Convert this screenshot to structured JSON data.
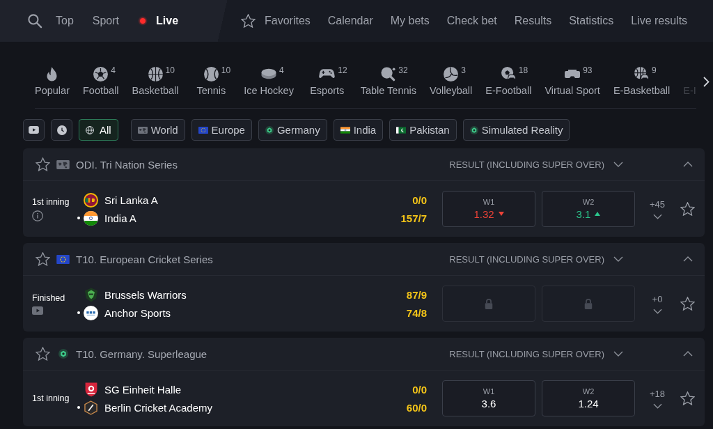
{
  "nav": {
    "primary": [
      {
        "label": "Top",
        "selected": false,
        "kind": "plain"
      },
      {
        "label": "Sport",
        "selected": false,
        "kind": "plain"
      },
      {
        "label": "Live",
        "selected": true,
        "kind": "live"
      }
    ],
    "secondary": [
      {
        "label": "Favorites",
        "kind": "starred"
      },
      {
        "label": "Calendar",
        "kind": "plain"
      },
      {
        "label": "My bets",
        "kind": "plain"
      },
      {
        "label": "Check bet",
        "kind": "plain"
      },
      {
        "label": "Results",
        "kind": "plain"
      },
      {
        "label": "Statistics",
        "kind": "plain"
      },
      {
        "label": "Live results",
        "kind": "plain"
      }
    ]
  },
  "sports": [
    {
      "label": "Popular",
      "kind": "popular",
      "faded": false
    },
    {
      "label": "Football",
      "count": "4",
      "kind": "football",
      "faded": false
    },
    {
      "label": "Basketball",
      "count": "10",
      "kind": "basketball",
      "faded": false
    },
    {
      "label": "Tennis",
      "count": "10",
      "kind": "tennis",
      "faded": false
    },
    {
      "label": "Ice Hockey",
      "count": "4",
      "kind": "hockey",
      "faded": false
    },
    {
      "label": "Esports",
      "count": "12",
      "kind": "esports",
      "faded": false
    },
    {
      "label": "Table Tennis",
      "count": "32",
      "kind": "pingpong",
      "faded": false
    },
    {
      "label": "Volleyball",
      "count": "3",
      "kind": "volleyball",
      "faded": false
    },
    {
      "label": "E-Football",
      "count": "18",
      "kind": "efootball",
      "faded": false
    },
    {
      "label": "Virtual Sport",
      "count": "93",
      "kind": "virtual",
      "faded": false
    },
    {
      "label": "E-Basketball",
      "count": "9",
      "kind": "ebasketball",
      "faded": false
    },
    {
      "label": "E-I",
      "kind": "cut",
      "faded": true
    }
  ],
  "filters": [
    {
      "label": "All",
      "kind": "globe",
      "selected": true
    },
    {
      "label": "World",
      "kind": "world",
      "selected": false
    },
    {
      "label": "Europe",
      "kind": "europe",
      "selected": false
    },
    {
      "label": "Germany",
      "kind": "hex",
      "selected": false
    },
    {
      "label": "India",
      "kind": "india",
      "selected": false
    },
    {
      "label": "Pakistan",
      "kind": "pakistan",
      "selected": false
    },
    {
      "label": "Simulated Reality",
      "kind": "hex",
      "selected": false
    }
  ],
  "leagues": [
    {
      "title": "ODI. Tri Nation Series",
      "kind": "world",
      "favorite": false,
      "market": "RESULT (INCLUDING SUPER OVER)",
      "expanded": true,
      "matches": [
        {
          "status": {
            "label": "1st inning",
            "kind": "info"
          },
          "teams": [
            {
              "name": "Sri Lanka A",
              "kind": "srilanka",
              "serving": false
            },
            {
              "name": "India A",
              "kind": "india",
              "serving": true
            }
          ],
          "scores": [
            "0/0",
            "157/7"
          ],
          "odds": [
            {
              "kind": "falling",
              "label": "W1",
              "value": "1.32"
            },
            {
              "kind": "rising",
              "label": "W2",
              "value": "3.1"
            }
          ],
          "more": "+45",
          "favorite": false
        }
      ]
    },
    {
      "title": "T10. European Cricket Series",
      "kind": "europe",
      "favorite": false,
      "market": "RESULT (INCLUDING SUPER OVER)",
      "expanded": true,
      "matches": [
        {
          "status": {
            "label": "Finished",
            "kind": "video"
          },
          "teams": [
            {
              "name": "Brussels Warriors",
              "kind": "brussels",
              "serving": false
            },
            {
              "name": "Anchor Sports",
              "kind": "anchor",
              "serving": true
            }
          ],
          "scores": [
            "87/9",
            "74/8"
          ],
          "odds": [
            {
              "kind": "locked"
            },
            {
              "kind": "locked"
            }
          ],
          "more": "+0",
          "favorite": false
        }
      ]
    },
    {
      "title": "T10. Germany. Superleague",
      "kind": "hex",
      "favorite": false,
      "market": "RESULT (INCLUDING SUPER OVER)",
      "expanded": true,
      "matches": [
        {
          "status": {
            "label": "1st inning",
            "kind": "plain"
          },
          "teams": [
            {
              "name": "SG Einheit Halle",
              "kind": "halle",
              "serving": false
            },
            {
              "name": "Berlin Cricket Academy",
              "kind": "berlin",
              "serving": true
            }
          ],
          "scores": [
            "0/0",
            "60/0"
          ],
          "odds": [
            {
              "kind": "steady",
              "label": "W1",
              "value": "3.6"
            },
            {
              "kind": "steady",
              "label": "W2",
              "value": "1.24"
            }
          ],
          "more": "+18",
          "favorite": false
        }
      ]
    }
  ]
}
